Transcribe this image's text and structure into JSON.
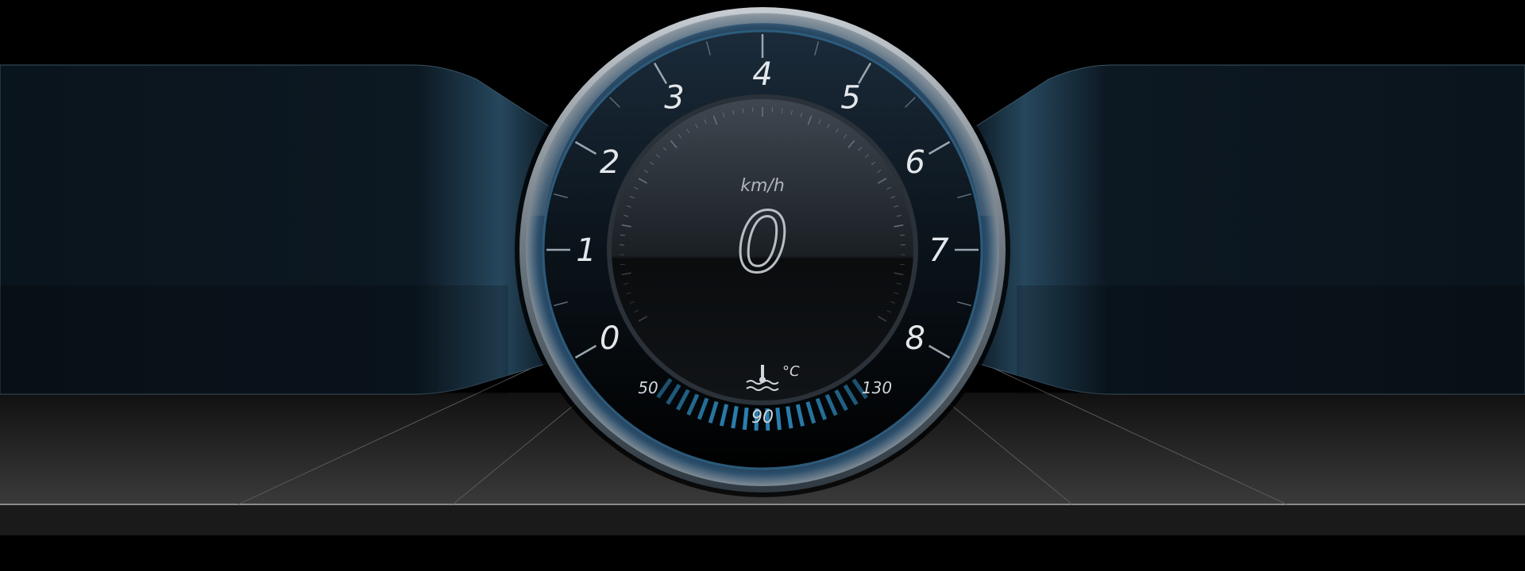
{
  "cluster": {
    "tachometer": {
      "labels": [
        "0",
        "1",
        "2",
        "3",
        "4",
        "5",
        "6",
        "7",
        "8"
      ],
      "rpm_x1000": 0
    },
    "speedometer": {
      "unit": "km/h",
      "speed": "0"
    },
    "coolant": {
      "icon": "coolant-temperature-icon",
      "unit": "°C",
      "min_label": "50",
      "mid_label": "90",
      "max_label": "130"
    }
  },
  "colors": {
    "background": "#000000",
    "accent_blue": "#2f8fc4",
    "panel_blue": "#0d1b26",
    "text": "#cfd6dc"
  }
}
